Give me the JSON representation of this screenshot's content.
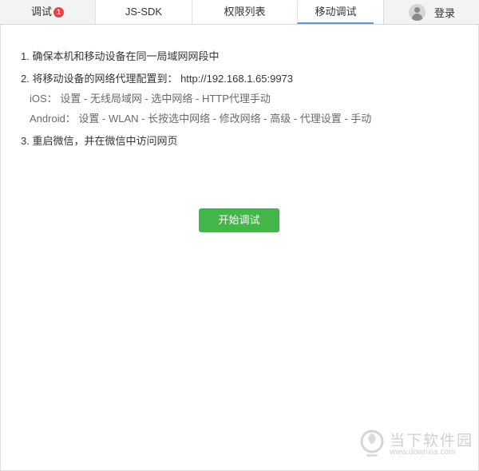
{
  "tabs": [
    {
      "label": "调试",
      "badge": "1"
    },
    {
      "label": "JS-SDK"
    },
    {
      "label": "权限列表"
    },
    {
      "label": "移动调试",
      "active": true
    }
  ],
  "login": {
    "label": "登录",
    "icon": "user-avatar-icon"
  },
  "steps": {
    "step1": "1. 确保本机和移动设备在同一局域网网段中",
    "step2": "2. 将移动设备的网络代理配置到： http://192.168.1.65:9973",
    "ios": "iOS： 设置 - 无线局域网 - 选中网络 - HTTP代理手动",
    "android": "Android： 设置 - WLAN - 长按选中网络 - 修改网络 - 高级 - 代理设置 - 手动",
    "step3": "3. 重启微信，并在微信中访问网页"
  },
  "start_button": {
    "label": "开始调试"
  },
  "watermark": {
    "title": "当下软件园",
    "url": "www.downxia.com"
  },
  "colors": {
    "accent_green": "#44b549",
    "badge_red": "#e64340",
    "active_tab_underline": "#5a9bd8"
  }
}
